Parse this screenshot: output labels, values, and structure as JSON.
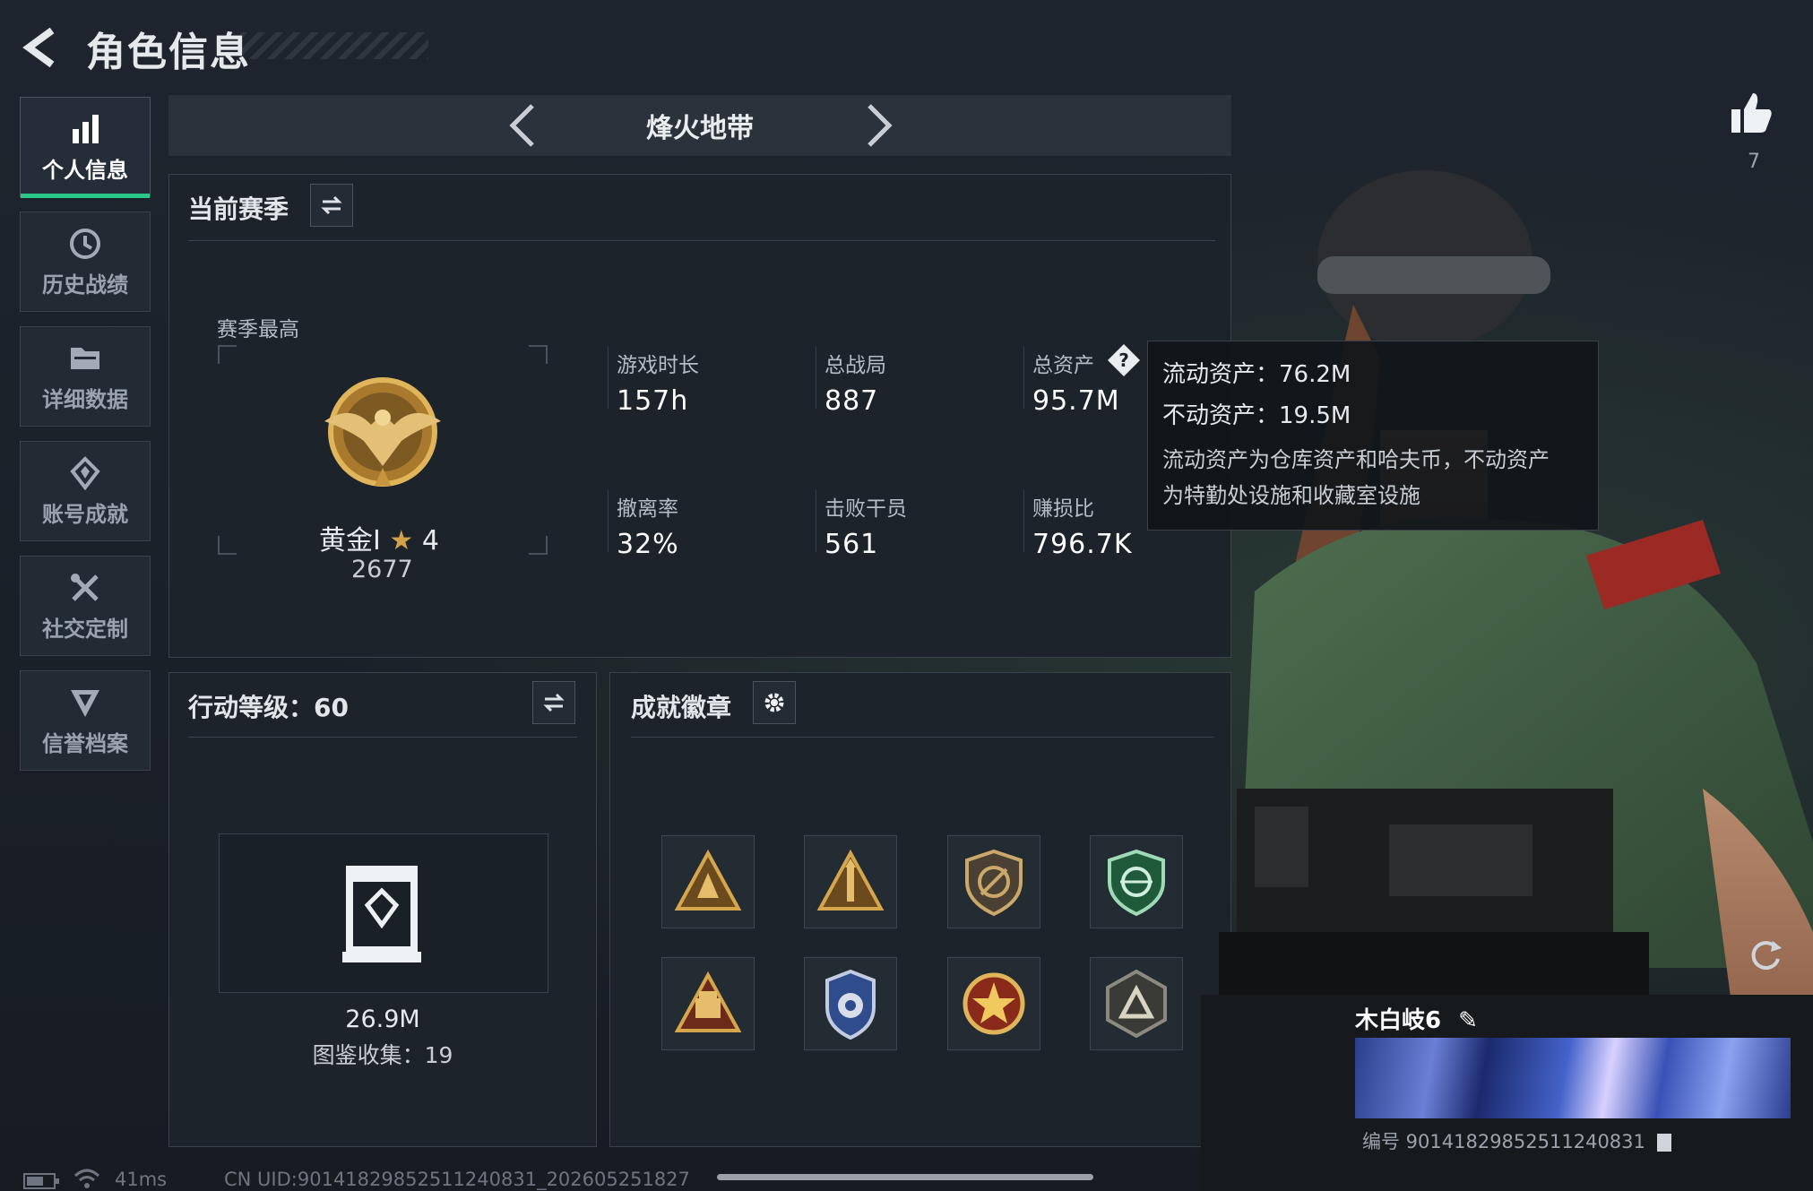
{
  "header": {
    "title": "角色信息"
  },
  "sidebar": {
    "items": [
      {
        "label": "个人信息",
        "icon": "bar-chart-icon",
        "active": true
      },
      {
        "label": "历史战绩",
        "icon": "history-icon"
      },
      {
        "label": "详细数据",
        "icon": "folder-icon"
      },
      {
        "label": "账号成就",
        "icon": "achievement-icon"
      },
      {
        "label": "社交定制",
        "icon": "tools-icon"
      },
      {
        "label": "信誉档案",
        "icon": "reputation-icon"
      }
    ]
  },
  "mode": {
    "title": "烽火地带"
  },
  "season": {
    "header": "当前赛季",
    "best_label": "赛季最高",
    "rank_name": "黄金I",
    "rank_stars": "4",
    "rank_score": "2677",
    "stats": [
      {
        "label": "游戏时长",
        "value": "157h"
      },
      {
        "label": "总战局",
        "value": "887"
      },
      {
        "label": "总资产",
        "value": "95.7M"
      },
      {
        "label": "撤离率",
        "value": "32%"
      },
      {
        "label": "击败干员",
        "value": "561"
      },
      {
        "label": "赚损比",
        "value": "796.7K"
      }
    ]
  },
  "tooltip": {
    "liquid": "流动资产：76.2M",
    "fixed": "不动资产：19.5M",
    "desc_line1": "流动资产为仓库资产和哈夫币，不动资产",
    "desc_line2": "为特勤处设施和收藏室设施"
  },
  "action_level": {
    "header": "行动等级：60",
    "value": "26.9M",
    "collection": "图鉴收集：19"
  },
  "badges": {
    "header": "成就徽章",
    "items": [
      "triangle-badge-1",
      "triangle-badge-2",
      "shield-gun-badge",
      "green-shield-badge",
      "crate-badge",
      "police-badge",
      "star-medal-badge",
      "dark-triangle-badge"
    ]
  },
  "profile": {
    "likes": "7",
    "name": "木白岐6",
    "uid_number": "编号 901418298525112408​31"
  },
  "footer": {
    "ping": "41ms",
    "uid": "CN UID:9014182985251124083​1_202605251827"
  },
  "colors": {
    "accent": "#29c98a",
    "gold": "#d2a24a"
  }
}
